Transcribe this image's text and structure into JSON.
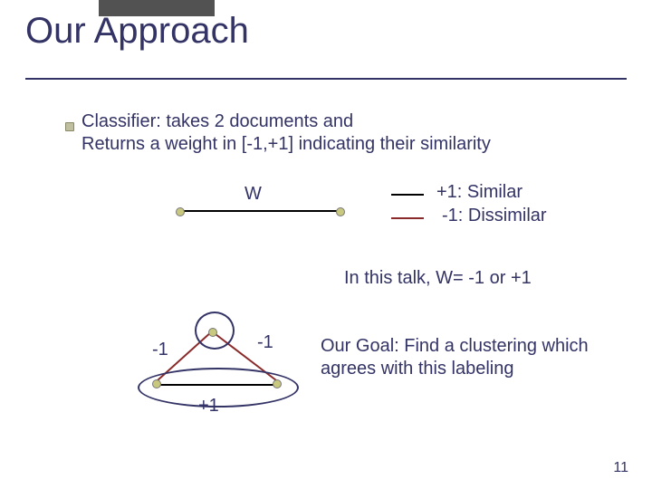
{
  "title": "Our Approach",
  "body": {
    "line1": "Classifier: takes 2 documents and",
    "line2": "Returns a weight in [-1,+1] indicating their similarity"
  },
  "diagram": {
    "w_edge_label": "W",
    "legend_similar": "+1: Similar",
    "legend_dissimilar": "-1: Dissimilar",
    "talk_note": "In this talk, W= -1 or +1",
    "goal": "Our Goal: Find a clustering which agrees with this labeling",
    "edge_neg1_a": "-1",
    "edge_neg1_b": "-1",
    "edge_pos1": "+1"
  },
  "slide_number": "11"
}
